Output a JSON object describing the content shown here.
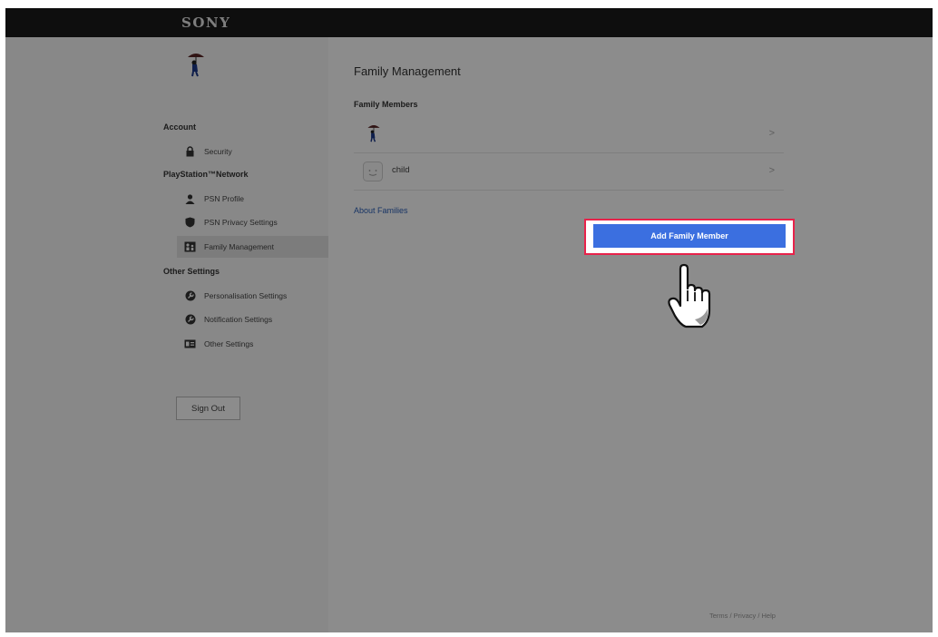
{
  "brand": {
    "logo": "SONY"
  },
  "sidebar": {
    "sections": {
      "account": "Account",
      "psn": "PlayStation™Network",
      "other": "Other Settings"
    },
    "items": [
      {
        "label": "Security",
        "icon": "lock-icon"
      },
      {
        "label": "PSN Profile",
        "icon": "person-icon"
      },
      {
        "label": "PSN Privacy Settings",
        "icon": "shield-icon"
      },
      {
        "label": "Family Management",
        "icon": "family-icon",
        "selected": true
      },
      {
        "label": "Personalisation Settings",
        "icon": "wrench-icon"
      },
      {
        "label": "Notification Settings",
        "icon": "wrench-icon"
      },
      {
        "label": "Other Settings",
        "icon": "id-card-icon"
      }
    ],
    "sign_out": "Sign Out"
  },
  "main": {
    "title": "Family Management",
    "members_heading": "Family Members",
    "members": [
      {
        "name": "",
        "avatar": "umbrella-avatar-icon"
      },
      {
        "name": "child",
        "avatar": "smiley-avatar-icon"
      }
    ],
    "chevron": ">",
    "about_link": "About Families",
    "add_button": "Add Family Member"
  },
  "footer": {
    "links": "Terms / Privacy / Help"
  },
  "colors": {
    "accent_button": "#3b6fe0",
    "highlight_outline": "#e8224a",
    "link": "#2b5fb8",
    "topbar": "#1a1a1a"
  }
}
